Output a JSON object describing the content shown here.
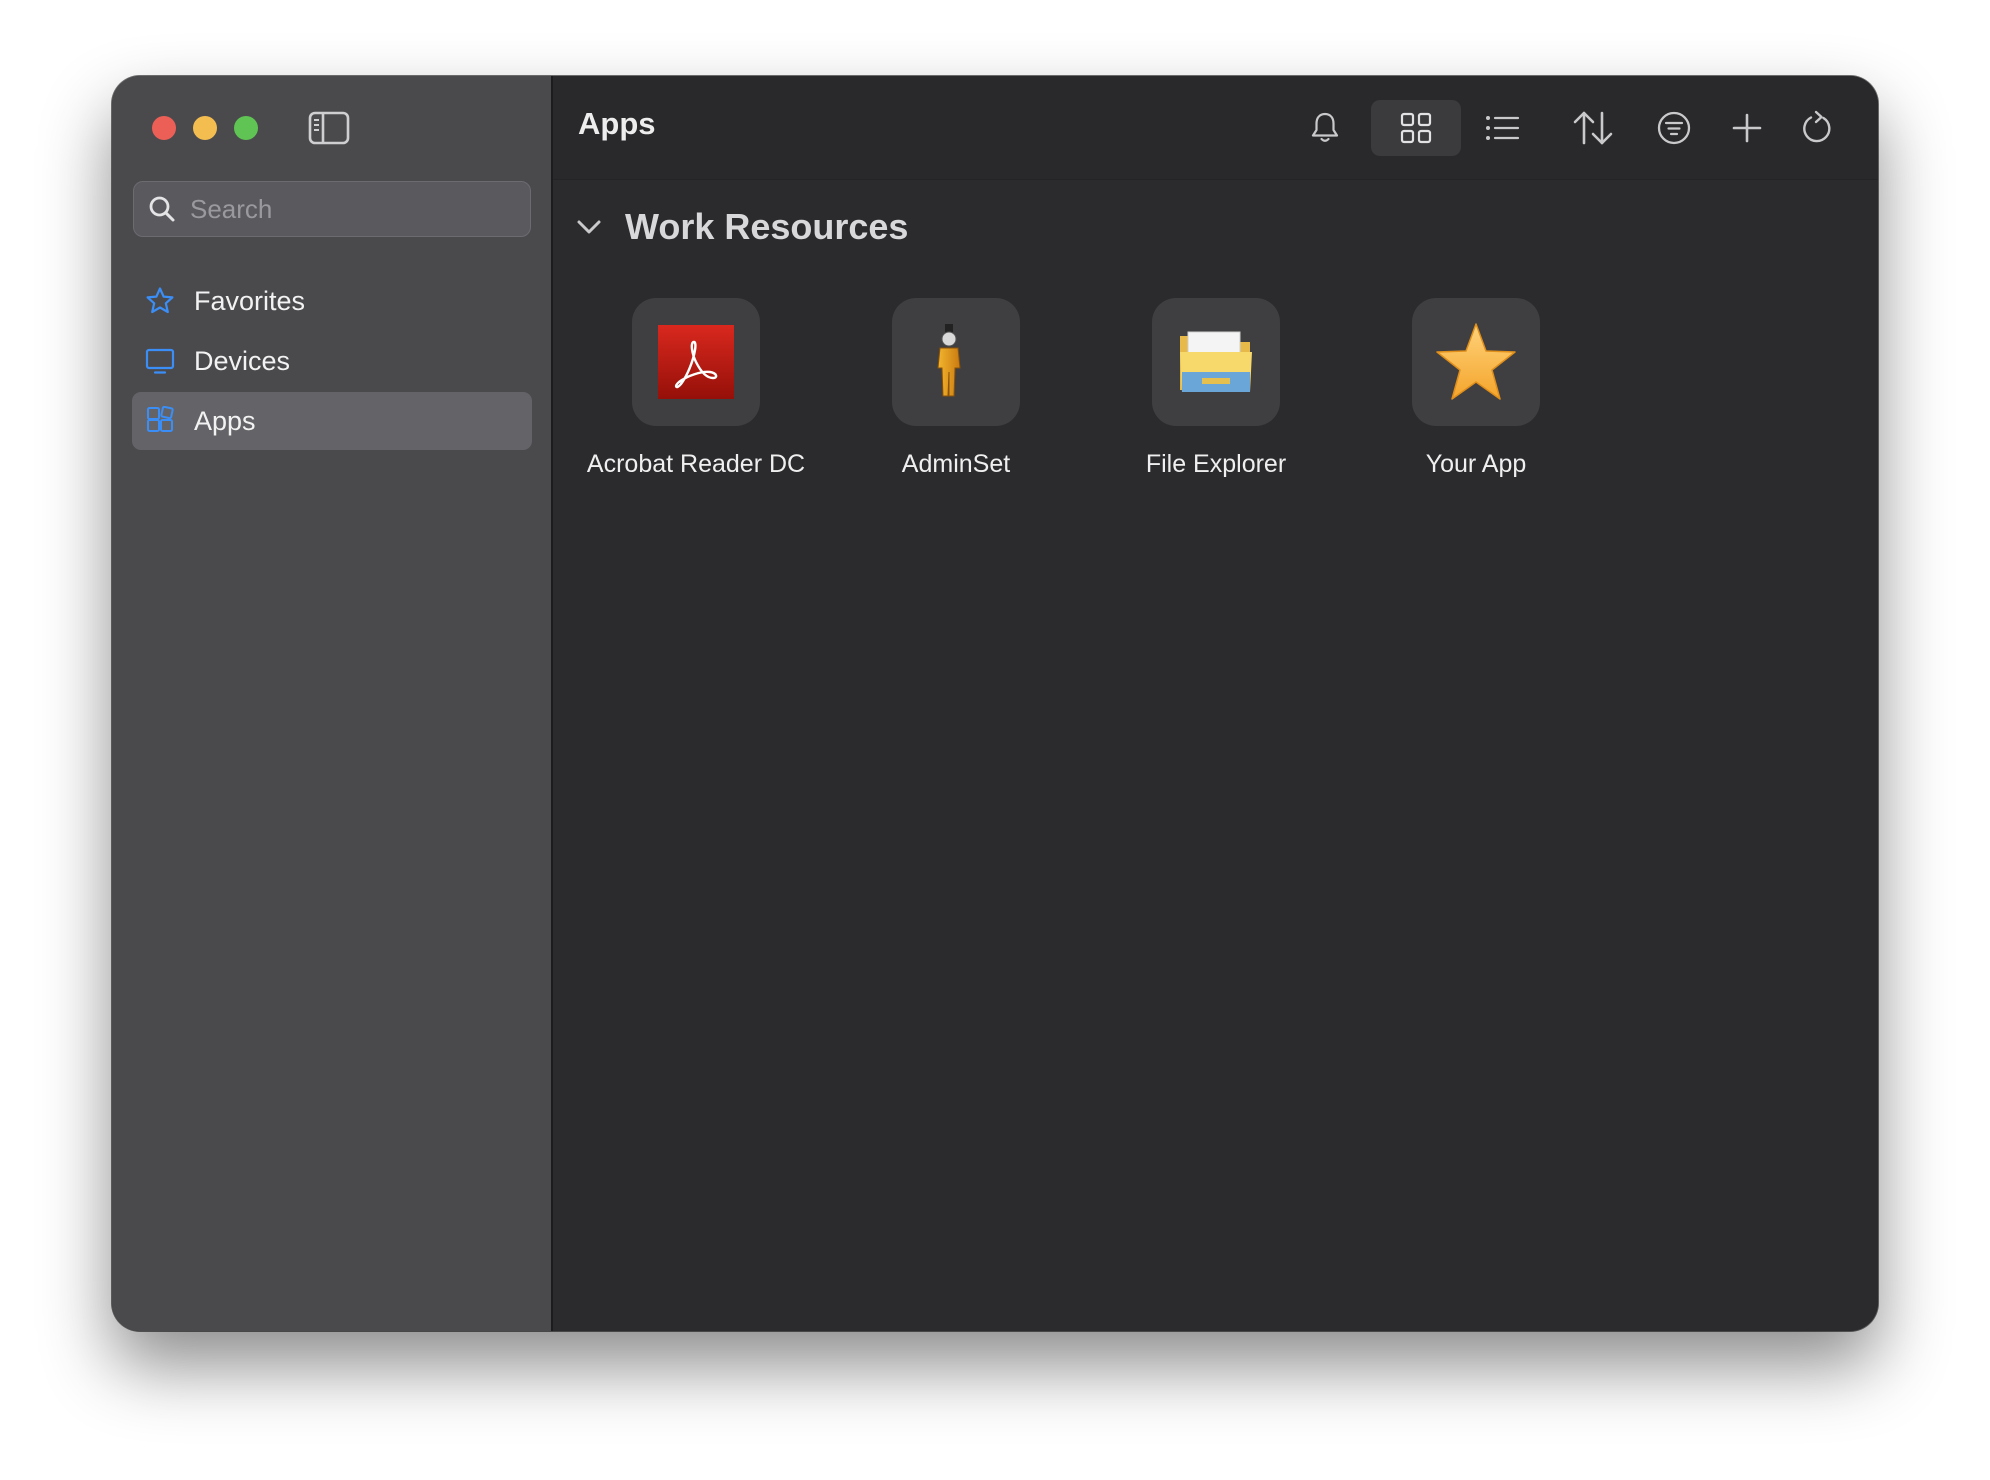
{
  "window": {
    "traffic_lights": {
      "close_color": "#ec5f57",
      "minimize_color": "#f4bd4f",
      "zoom_color": "#5fc454"
    }
  },
  "sidebar": {
    "search": {
      "placeholder": "Search",
      "value": ""
    },
    "items": [
      {
        "label": "Favorites",
        "icon": "star-icon",
        "active": false
      },
      {
        "label": "Devices",
        "icon": "monitor-icon",
        "active": false
      },
      {
        "label": "Apps",
        "icon": "apps-icon",
        "active": true
      }
    ],
    "accent_color": "#3a8ef6"
  },
  "toolbar": {
    "title": "Apps",
    "buttons": [
      {
        "icon": "bell-icon"
      },
      {
        "icon": "grid-view-icon",
        "active": true
      },
      {
        "icon": "list-view-icon"
      },
      {
        "icon": "sort-icon"
      },
      {
        "icon": "filter-icon"
      },
      {
        "icon": "plus-icon"
      },
      {
        "icon": "refresh-icon"
      }
    ]
  },
  "content": {
    "section": {
      "title": "Work Resources",
      "expanded": true
    },
    "apps": [
      {
        "label": "Acrobat Reader DC",
        "icon": "acrobat-reader-icon"
      },
      {
        "label": "AdminSet",
        "icon": "adminset-icon"
      },
      {
        "label": "File Explorer",
        "icon": "file-explorer-icon"
      },
      {
        "label": "Your App",
        "icon": "star-app-icon"
      }
    ]
  }
}
